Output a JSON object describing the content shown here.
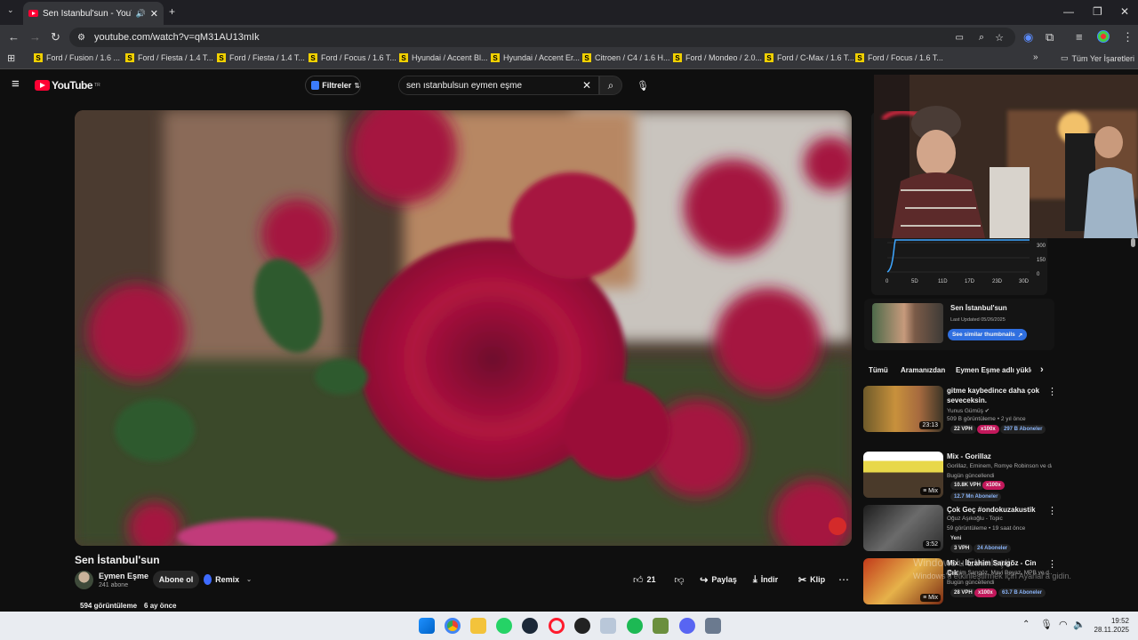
{
  "browser": {
    "tab_title": "Sen İstanbul'sun - YouTube",
    "url": "youtube.com/watch?v=qM31AU13mIk",
    "bookmarks": [
      "Ford / Fusion / 1.6 ...",
      "Ford / Fiesta / 1.4 T...",
      "Ford / Fiesta / 1.4 T...",
      "Ford / Focus / 1.6 T...",
      "Hyundai / Accent Bl...",
      "Hyundai / Accent Er...",
      "Citroen / C4 / 1.6 H...",
      "Ford / Mondeo / 2.0...",
      "Ford / C-Max / 1.6 T...",
      "Ford / Focus / 1.6 T..."
    ],
    "all_bookmarks": "Tüm Yer İşaretleri"
  },
  "youtube": {
    "logo": "YouTube",
    "country": "TR",
    "filters": "Filtreler",
    "search_value": "sen ıstanbulsun eymen eşme"
  },
  "video": {
    "title": "Sen İstanbul'sun",
    "channel": "Eymen Eşme",
    "subscribers": "241 abone",
    "subscribe": "Abone ol",
    "remix": "Remix",
    "likes": "21",
    "share": "Paylaş",
    "download": "İndir",
    "clip": "Klip",
    "views": "594 görüntüleme",
    "age": "6 ay önce"
  },
  "vph_panel": {
    "y_ticks": [
      "300",
      "150",
      "0"
    ],
    "x_ticks": [
      "0",
      "5D",
      "11D",
      "17D",
      "23D",
      "30D"
    ],
    "thumb_title": "Sen İstanbul'sun",
    "last_updated": "Last Updated 05/26/2025",
    "similar_button": "See similar thumbnails"
  },
  "chips": [
    "Tümü",
    "Aramanızdan",
    "Eymen Eşme adlı yükleyen"
  ],
  "recommendations": [
    {
      "title": "gitme kaybedince daha çok seveceksin.",
      "channel": "Yunus Gümüş",
      "meta": "509 B görüntüleme • 2 yıl önce",
      "duration": "23:13",
      "vph": "22 VPH",
      "x": "x100x",
      "subs": "297 B Aboneler"
    },
    {
      "title": "Mix - Gorillaz",
      "channel": "Gorillaz, Eminem, Romye Robinson ve da...",
      "meta": "Bugün güncellendi",
      "duration": "Mix",
      "vph": "10.8K VPH",
      "x": "x100x",
      "subs": "12.7 Mn Aboneler"
    },
    {
      "title": "Çok Geç #ondokuzakustik",
      "channel": "Oğuz Aşıkoğlu - Topic",
      "meta": "59 görüntüleme • 19 saat önce",
      "duration": "3:52",
      "new": "Yeni",
      "vph": "3 VPH",
      "subs": "24 Aboneler"
    },
    {
      "title": "Mix - İbrahim Sarıgöz - Cin Çık",
      "channel": "İbrahim Sarıgöz, Mavi Beyaz, MPB ve d...",
      "meta": "Bugün güncellendi",
      "duration": "Mix",
      "vph": "28 VPH",
      "x": "x100x",
      "subs": "63.7 B Aboneler"
    }
  ],
  "watermark": {
    "line1": "Windows'u Etkinleştir",
    "line2": "Windows'u etkinleştirmek için Ayarlar'a gidin."
  },
  "taskbar": {
    "time": "19:52",
    "date": "28.11.2025"
  },
  "colors": {
    "yt_red": "#ff0033",
    "accent_blue": "#3ea6ff",
    "vph_pink": "#c2185b"
  }
}
